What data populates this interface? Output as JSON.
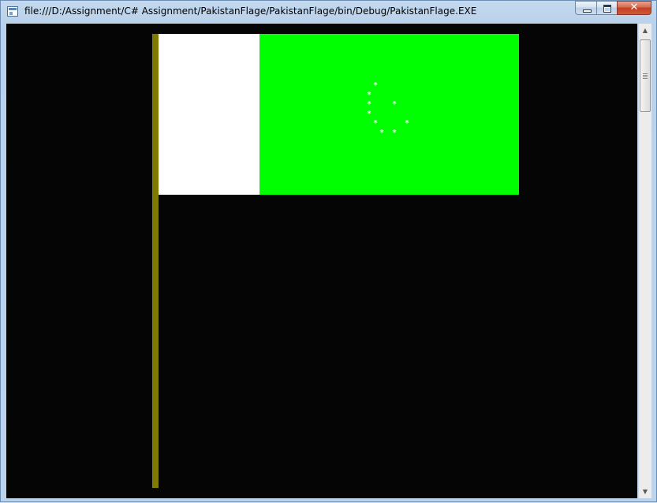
{
  "window": {
    "title": "file:///D:/Assignment/C# Assignment/PakistanFlage/PakistanFlage/bin/Debug/PakistanFlage.EXE",
    "app_icon": "application-window-icon",
    "controls": {
      "minimize_icon": "minimize-icon",
      "maximize_icon": "maximize-icon",
      "close_icon": "close-icon",
      "close_glyph": "✕"
    }
  },
  "canvas": {
    "background": "#050505",
    "pole_color": "#7f7a00",
    "white_band_color": "#ffffff",
    "green_field_color": "#00ff00",
    "star_glyph": "*",
    "star_color": "#ffffff"
  },
  "scrollbar": {
    "up_arrow": "▲",
    "down_arrow": "▼"
  }
}
